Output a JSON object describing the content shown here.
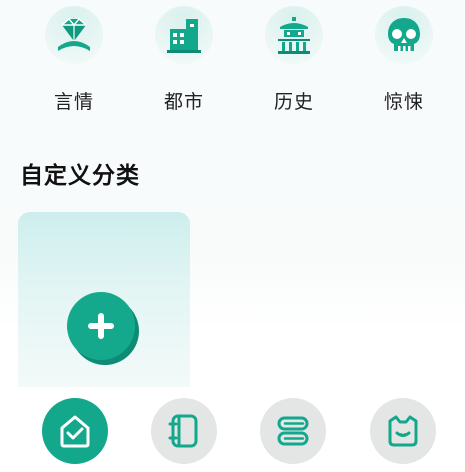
{
  "genres": [
    {
      "label": "言情",
      "icon": "diamond-ring-icon"
    },
    {
      "label": "都市",
      "icon": "city-buildings-icon"
    },
    {
      "label": "历史",
      "icon": "pagoda-icon"
    },
    {
      "label": "惊悚",
      "icon": "skull-icon"
    }
  ],
  "custom_section": {
    "title": "自定义分类",
    "add_icon": "plus-icon"
  },
  "bottom_nav": [
    {
      "icon": "home-check-icon",
      "active": true
    },
    {
      "icon": "book-icon",
      "active": false
    },
    {
      "icon": "list-tags-icon",
      "active": false
    },
    {
      "icon": "bear-face-icon",
      "active": false
    }
  ],
  "colors": {
    "accent": "#13a88c",
    "accent_dark": "#0d8b74",
    "inactive_nav": "#e4e6e6",
    "card_top": "#cdeeed"
  }
}
